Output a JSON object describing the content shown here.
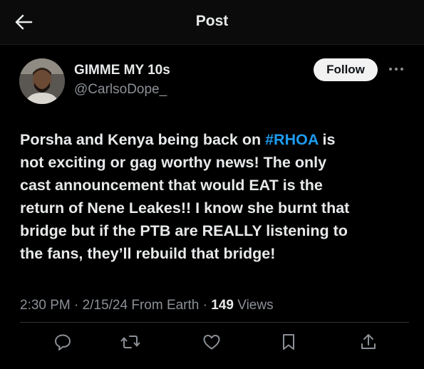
{
  "header": {
    "title": "Post",
    "back_icon": "arrow-left-icon"
  },
  "author": {
    "display_name": "GIMME MY 10s",
    "handle": "@CarlsoDope_",
    "follow_label": "Follow",
    "more_icon": "more-horizontal-icon"
  },
  "tweet": {
    "lines": [
      {
        "before": "Porsha and Kenya being back on ",
        "hashtag": "#RHOA",
        "after": " is"
      },
      {
        "text": "not exciting or gag worthy news! The only"
      },
      {
        "text": "cast announcement that would EAT is the"
      },
      {
        "text": "return of Nene Leakes!! I know she burnt that"
      },
      {
        "text": "bridge but if the PTB are REALLY listening to"
      },
      {
        "text": "the fans, they’ll rebuild that bridge!"
      }
    ]
  },
  "meta": {
    "time": "2:30 PM",
    "sep1": " · ",
    "date": "2/15/24",
    "source": " From Earth",
    "sep2": " · ",
    "views_count": "149",
    "views_label": " Views"
  },
  "actions": [
    "reply-icon",
    "repost-icon",
    "like-icon",
    "bookmark-icon",
    "share-icon"
  ],
  "colors": {
    "background": "#000000",
    "text": "#e7e9ea",
    "muted": "#8b9096",
    "link": "#1d9bf0"
  }
}
